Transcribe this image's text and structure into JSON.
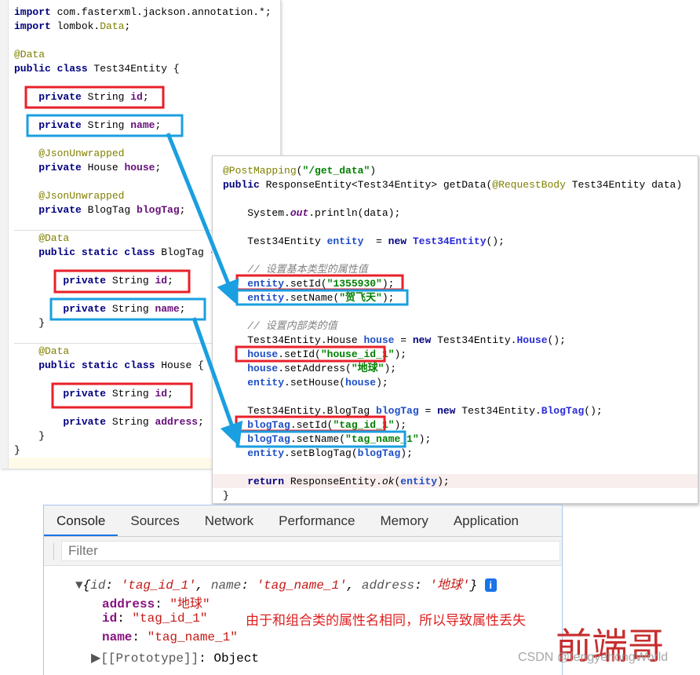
{
  "left_code": {
    "lines": [
      [
        [
          "import",
          "kw"
        ],
        [
          " com.fasterxml.jackson.annotation.*;",
          ""
        ]
      ],
      [
        [
          "import",
          "kw"
        ],
        [
          " lombok.",
          ""
        ],
        [
          "Data",
          "ann"
        ],
        [
          ";",
          ""
        ]
      ],
      [],
      [
        [
          "@Data",
          "ann"
        ]
      ],
      [
        [
          "public class",
          "kw"
        ],
        [
          " Test34Entity {",
          ""
        ]
      ],
      [],
      [
        [
          "    private",
          "kw"
        ],
        [
          " String ",
          ""
        ],
        [
          "id",
          "fld"
        ],
        [
          ";",
          ""
        ]
      ],
      [],
      [
        [
          "    private",
          "kw"
        ],
        [
          " String ",
          ""
        ],
        [
          "name",
          "fld"
        ],
        [
          ";",
          ""
        ]
      ],
      [],
      [
        [
          "    @JsonUnwrapped",
          "ann"
        ]
      ],
      [
        [
          "    private",
          "kw"
        ],
        [
          " House ",
          ""
        ],
        [
          "house",
          "fld"
        ],
        [
          ";",
          ""
        ]
      ],
      [],
      [
        [
          "    @JsonUnwrapped",
          "ann"
        ]
      ],
      [
        [
          "    private",
          "kw"
        ],
        [
          " BlogTag ",
          ""
        ],
        [
          "blogTag",
          "fld"
        ],
        [
          ";",
          ""
        ]
      ],
      [],
      [
        [
          "    @Data",
          "ann"
        ]
      ],
      [
        [
          "    public static class",
          "kw"
        ],
        [
          " BlogTag {",
          ""
        ]
      ],
      [],
      [
        [
          "        private",
          "kw"
        ],
        [
          " String ",
          ""
        ],
        [
          "id",
          "fld"
        ],
        [
          ";",
          ""
        ]
      ],
      [],
      [
        [
          "        private",
          "kw"
        ],
        [
          " String ",
          ""
        ],
        [
          "name",
          "fld"
        ],
        [
          ";",
          ""
        ]
      ],
      [
        [
          "    }",
          ""
        ]
      ],
      [],
      [
        [
          "    @Data",
          "ann"
        ]
      ],
      [
        [
          "    public static class",
          "kw"
        ],
        [
          " House {",
          ""
        ]
      ],
      [],
      [
        [
          "        private",
          "kw"
        ],
        [
          " String ",
          ""
        ],
        [
          "id",
          "fld"
        ],
        [
          ";",
          ""
        ]
      ],
      [],
      [
        [
          "        private",
          "kw"
        ],
        [
          " String ",
          ""
        ],
        [
          "address",
          "fld"
        ],
        [
          ";",
          ""
        ]
      ],
      [
        [
          "    }",
          ""
        ]
      ],
      [
        [
          "}",
          ""
        ]
      ]
    ]
  },
  "right_code": {
    "lines": [
      [
        [
          "@PostMapping",
          "ann"
        ],
        [
          "(",
          ""
        ],
        [
          "\"/get_data\"",
          "str"
        ],
        [
          ")",
          ""
        ]
      ],
      [
        [
          "public",
          "kw"
        ],
        [
          " ResponseEntity<Test34Entity> getData(",
          ""
        ],
        [
          "@RequestBody",
          "ann"
        ],
        [
          " Test34Entity data)",
          ""
        ]
      ],
      [],
      [
        [
          "    System.",
          ""
        ],
        [
          "out",
          "st"
        ],
        [
          ".println(data);",
          ""
        ]
      ],
      [],
      [
        [
          "    Test34Entity ",
          ""
        ],
        [
          "entity",
          "var"
        ],
        [
          "  = ",
          ""
        ],
        [
          "new",
          "kw"
        ],
        [
          " ",
          ""
        ],
        [
          "Test34Entity",
          "ctor"
        ],
        [
          "();",
          ""
        ]
      ],
      [],
      [
        [
          "    // 设置基本类型的属性值",
          "cm"
        ]
      ],
      [
        [
          "    ",
          ""
        ],
        [
          "entity",
          "var"
        ],
        [
          ".setId(",
          ""
        ],
        [
          "\"1355930\"",
          "str"
        ],
        [
          ");",
          ""
        ]
      ],
      [
        [
          "    ",
          ""
        ],
        [
          "entity",
          "var"
        ],
        [
          ".setName(",
          ""
        ],
        [
          "\"贺飞天\"",
          "str"
        ],
        [
          ");",
          ""
        ]
      ],
      [],
      [
        [
          "    // 设置内部类的值",
          "cm"
        ]
      ],
      [
        [
          "    Test34Entity.House ",
          ""
        ],
        [
          "house",
          "var"
        ],
        [
          " = ",
          ""
        ],
        [
          "new",
          "kw"
        ],
        [
          " Test34Entity.",
          ""
        ],
        [
          "House",
          "ctor"
        ],
        [
          "();",
          ""
        ]
      ],
      [
        [
          "    ",
          ""
        ],
        [
          "house",
          "var"
        ],
        [
          ".setId(",
          ""
        ],
        [
          "\"house_id_1\"",
          "str"
        ],
        [
          ");",
          ""
        ]
      ],
      [
        [
          "    ",
          ""
        ],
        [
          "house",
          "var"
        ],
        [
          ".setAddress(",
          ""
        ],
        [
          "\"地球\"",
          "str"
        ],
        [
          ");",
          ""
        ]
      ],
      [
        [
          "    ",
          ""
        ],
        [
          "entity",
          "var"
        ],
        [
          ".setHouse(",
          ""
        ],
        [
          "house",
          "var"
        ],
        [
          ");",
          ""
        ]
      ],
      [],
      [
        [
          "    Test34Entity.BlogTag ",
          ""
        ],
        [
          "blogTag",
          "var"
        ],
        [
          " = ",
          ""
        ],
        [
          "new",
          "kw"
        ],
        [
          " Test34Entity.",
          ""
        ],
        [
          "BlogTag",
          "ctor"
        ],
        [
          "();",
          ""
        ]
      ],
      [
        [
          "    ",
          ""
        ],
        [
          "blogTag",
          "var"
        ],
        [
          ".setId(",
          ""
        ],
        [
          "\"tag_id_1\"",
          "str"
        ],
        [
          ");",
          ""
        ]
      ],
      [
        [
          "    ",
          ""
        ],
        [
          "blogTag",
          "var"
        ],
        [
          ".setName(",
          ""
        ],
        [
          "\"tag_name_1\"",
          "str"
        ],
        [
          ");",
          ""
        ]
      ],
      [
        [
          "    ",
          ""
        ],
        [
          "entity",
          "var"
        ],
        [
          ".setBlogTag(",
          ""
        ],
        [
          "blogTag",
          "var"
        ],
        [
          ");",
          ""
        ]
      ],
      [],
      [
        [
          "    return",
          "kw"
        ],
        [
          " ResponseEntity.",
          ""
        ],
        [
          "ok",
          "it"
        ],
        [
          "(",
          ""
        ],
        [
          "entity",
          "var"
        ],
        [
          ");",
          ""
        ]
      ],
      [
        [
          "}",
          ""
        ]
      ]
    ]
  },
  "devtools": {
    "tabs": [
      "Console",
      "Sources",
      "Network",
      "Performance",
      "Memory",
      "Application"
    ],
    "active_tab": "Console",
    "filter_placeholder": "Filter",
    "summary": {
      "open": "▼{",
      "id_key": "id",
      "id_val": "'tag_id_1'",
      "name_key": "name",
      "name_val": "'tag_name_1'",
      "addr_key": "address",
      "addr_val": "'地球'",
      "close": "}"
    },
    "props": [
      {
        "key": "address",
        "value": "\"地球\""
      },
      {
        "key": "id",
        "value": "\"tag_id_1\""
      },
      {
        "key": "name",
        "value": "\"tag_name_1\""
      }
    ],
    "prototype": {
      "label": "[[Prototype]]",
      "value": "Object"
    },
    "info_icon": "i"
  },
  "annotation": "由于和组合类的属性名相同，所以导致属性丢失",
  "watermark": {
    "logo": "前端哥",
    "csdn": "CSDN @fengyehongWorld"
  },
  "colors": {
    "red_box": "#e8202a",
    "blue_box": "#1a9fe0",
    "arrow": "#1a9fe0"
  }
}
